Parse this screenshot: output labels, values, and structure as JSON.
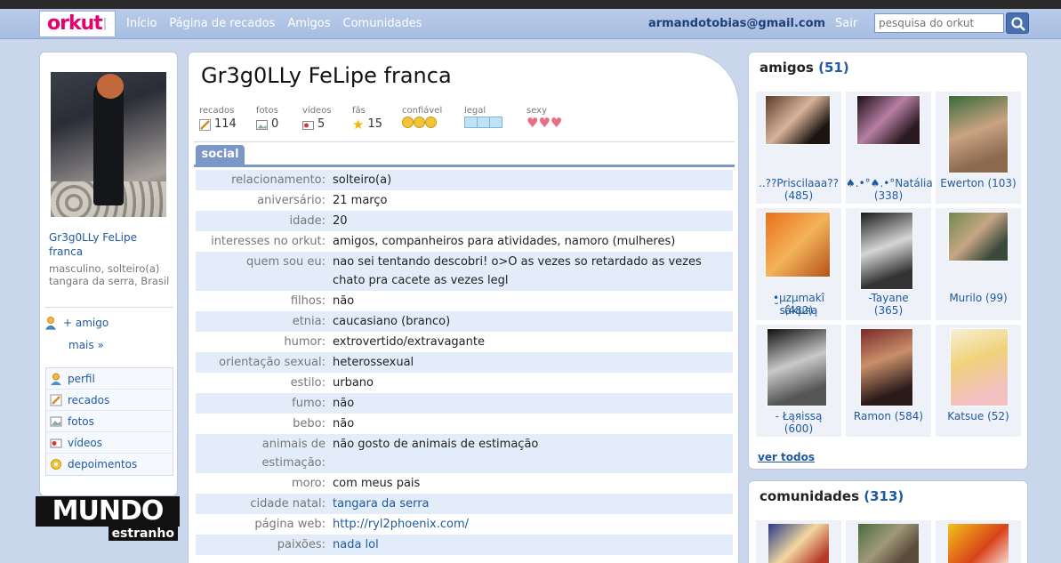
{
  "nav": {
    "logo": "orkut",
    "links": [
      "Início",
      "Página de recados",
      "Amigos",
      "Comunidades"
    ],
    "email": "armandotobias@gmail.com",
    "logout": "Sair",
    "search_placeholder": "pesquisa do orkut"
  },
  "left": {
    "name": "Gr3g0LLy FeLipe franca",
    "info": "masculino, solteiro(a) tangara da serra, Brasil",
    "add_friend": "+ amigo",
    "more": "mais »",
    "menu": [
      "perfil",
      "recados",
      "fotos",
      "vídeos",
      "depoimentos"
    ]
  },
  "watermark": {
    "top": "MUNDO",
    "bottom": "estranho"
  },
  "main": {
    "title": "Gr3g0LLy FeLipe franca",
    "stats": [
      {
        "label": "recados",
        "value": "114",
        "icon": "pencil-icon"
      },
      {
        "label": "fotos",
        "value": "0",
        "icon": "photo-icon"
      },
      {
        "label": "vídeos",
        "value": "5",
        "icon": "video-icon"
      },
      {
        "label": "fãs",
        "value": "15",
        "icon": "star-icon"
      },
      {
        "label": "confiável",
        "value": "",
        "icon": "smiley-icon"
      },
      {
        "label": "legal",
        "value": "",
        "icon": "ice-cube-icon"
      },
      {
        "label": "sexy",
        "value": "",
        "icon": "heart-icon"
      }
    ],
    "tab": "social",
    "rows": [
      {
        "label": "relacionamento:",
        "value": "solteiro(a)"
      },
      {
        "label": "aniversário:",
        "value": "21 março"
      },
      {
        "label": "idade:",
        "value": "20"
      },
      {
        "label": "interesses no orkut:",
        "value": "amigos, companheiros para atividades, namoro (mulheres)"
      },
      {
        "label": "quem sou eu:",
        "value": "nao sei tentando descobri! o>O as vezes so retardado as vezes chato pra cacete as vezes legl"
      },
      {
        "label": "filhos:",
        "value": "não"
      },
      {
        "label": "etnia:",
        "value": "caucasiano (branco)"
      },
      {
        "label": "humor:",
        "value": "extrovertido/extravagante"
      },
      {
        "label": "orientação sexual:",
        "value": "heterossexual"
      },
      {
        "label": "estilo:",
        "value": "urbano"
      },
      {
        "label": "fumo:",
        "value": "não"
      },
      {
        "label": "bebo:",
        "value": "não"
      },
      {
        "label": "animais de estimação:",
        "value": "não gosto de animais de estimação"
      },
      {
        "label": "moro:",
        "value": "com meus pais"
      },
      {
        "label": "cidade natal:",
        "value": "tangara da serra"
      },
      {
        "label": "página web:",
        "value": "http://ryl2phoenix.com/"
      },
      {
        "label": "paixões:",
        "value": "nada lol"
      }
    ]
  },
  "friends": {
    "title": "amigos",
    "count": "(51)",
    "items": [
      {
        "name": "..??Priscilaaa??",
        "count": "(485)"
      },
      {
        "name": "♠.•°♠.•°Natália",
        "count": "(338)"
      },
      {
        "name": "Ewerton (103)",
        "count": ""
      },
      {
        "name": "•̮μzμmakî sâkμяą",
        "count": "(482)"
      },
      {
        "name": "-Tayane",
        "count": "(365)"
      },
      {
        "name": "Murilo (99)",
        "count": ""
      },
      {
        "name": "- Łąяissą",
        "count": "(600)"
      },
      {
        "name": "Ramon (584)",
        "count": ""
      },
      {
        "name": "Katsue (52)",
        "count": ""
      }
    ],
    "view_all": "ver todos"
  },
  "communities": {
    "title": "comunidades",
    "count": "(313)"
  }
}
